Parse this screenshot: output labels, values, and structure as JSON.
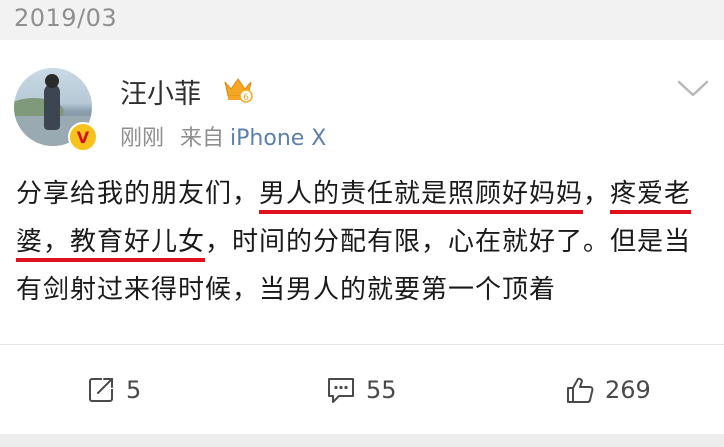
{
  "date_header": "2019/03",
  "post": {
    "username": "汪小菲",
    "badge_level": "6",
    "verified_mark": "V",
    "time": "刚刚",
    "source_prefix": "来自",
    "device": "iPhone X",
    "text_parts": [
      "分享给我的朋友们，",
      "男人的责任就是照顾好妈妈",
      "，",
      "疼爱老婆，教育好儿女",
      "，时间的分配有限，心在就好了。但是当有剑射过来得时候，当男人的就要第一个顶着"
    ]
  },
  "actions": {
    "repost_count": "5",
    "comment_count": "55",
    "like_count": "269"
  },
  "colors": {
    "highlight_underline": "#e0111f",
    "device_link": "#5b7fb0",
    "crown": "#f5a623",
    "verified_badge": "#f7c21c"
  },
  "icons": [
    "crown-icon",
    "chevron-down-icon",
    "repost-icon",
    "comment-icon",
    "like-icon"
  ]
}
